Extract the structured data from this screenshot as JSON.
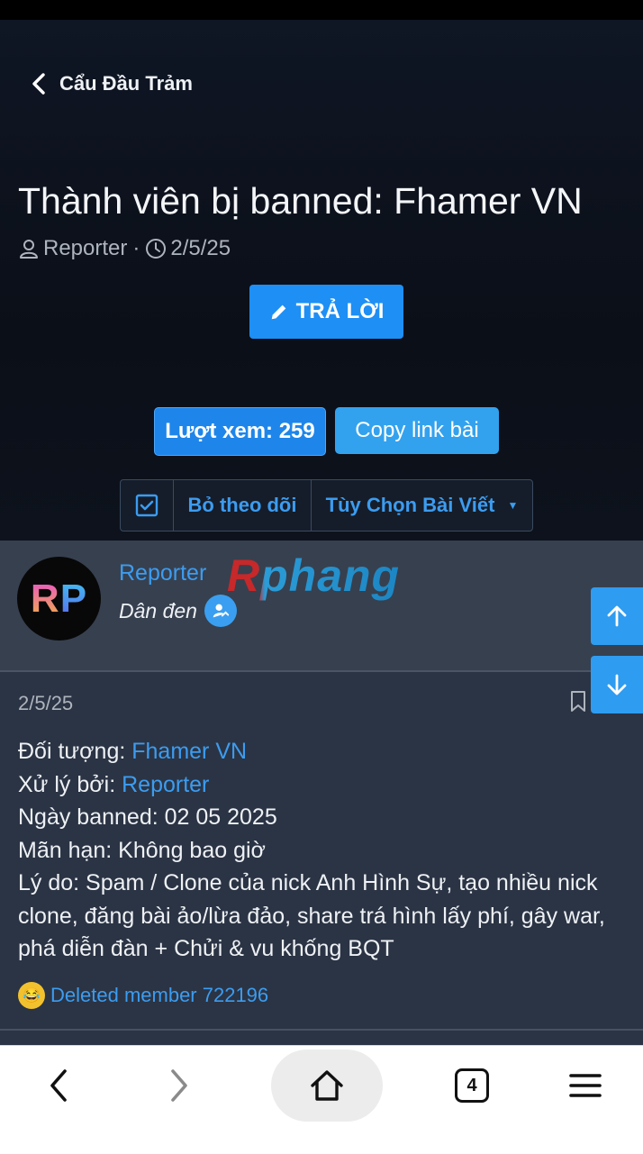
{
  "header": {
    "back_label": "Cẩu Đầu Trảm",
    "title": "Thành viên bị banned: Fhamer VN",
    "author": "Reporter",
    "separator": "·",
    "date": "2/5/25",
    "reply_label": "TRẢ LỜI",
    "views_label": "Lượt xem: 259",
    "copy_link_label": "Copy link bài",
    "follow_label": "Bỏ theo dõi",
    "options_label": "Tùy Chọn Bài Viết"
  },
  "post": {
    "username": "Reporter",
    "watermark": "Rphang",
    "user_title": "Dân đen",
    "date": "2/5/25",
    "target_label": "Đối tượng: ",
    "target_value": "Fhamer VN",
    "handled_label": "Xử lý bởi: ",
    "handled_value": "Reporter",
    "ban_date": "Ngày banned: 02 05 2025",
    "expiry": "Mãn hạn: Không bao giờ",
    "reason": "Lý do: Spam / Clone của nick Anh Hình Sự, tạo nhiều nick clone, đăng bài ảo/lừa đảo, share trá hình lấy phí, gây war, phá diễn đàn + Chửi & vu khống BQT",
    "reaction_user": "Deleted member 722196"
  },
  "avatar": {
    "letter1": "R",
    "letter2": "P"
  },
  "navbar": {
    "tab_count": "4"
  },
  "colors": {
    "accent": "#1e8ff5",
    "link": "#3c9cf0",
    "post_bg": "#2b3444"
  },
  "icons": [
    "chevron-left-icon",
    "user-icon",
    "clock-icon",
    "pencil-icon",
    "checkbox-icon",
    "caret-down-icon",
    "verified-icon",
    "arrow-up-icon",
    "arrow-down-icon",
    "bookmark-icon",
    "laugh-emoji-icon",
    "nav-back-icon",
    "nav-forward-icon",
    "home-icon",
    "tabs-icon",
    "menu-icon"
  ]
}
